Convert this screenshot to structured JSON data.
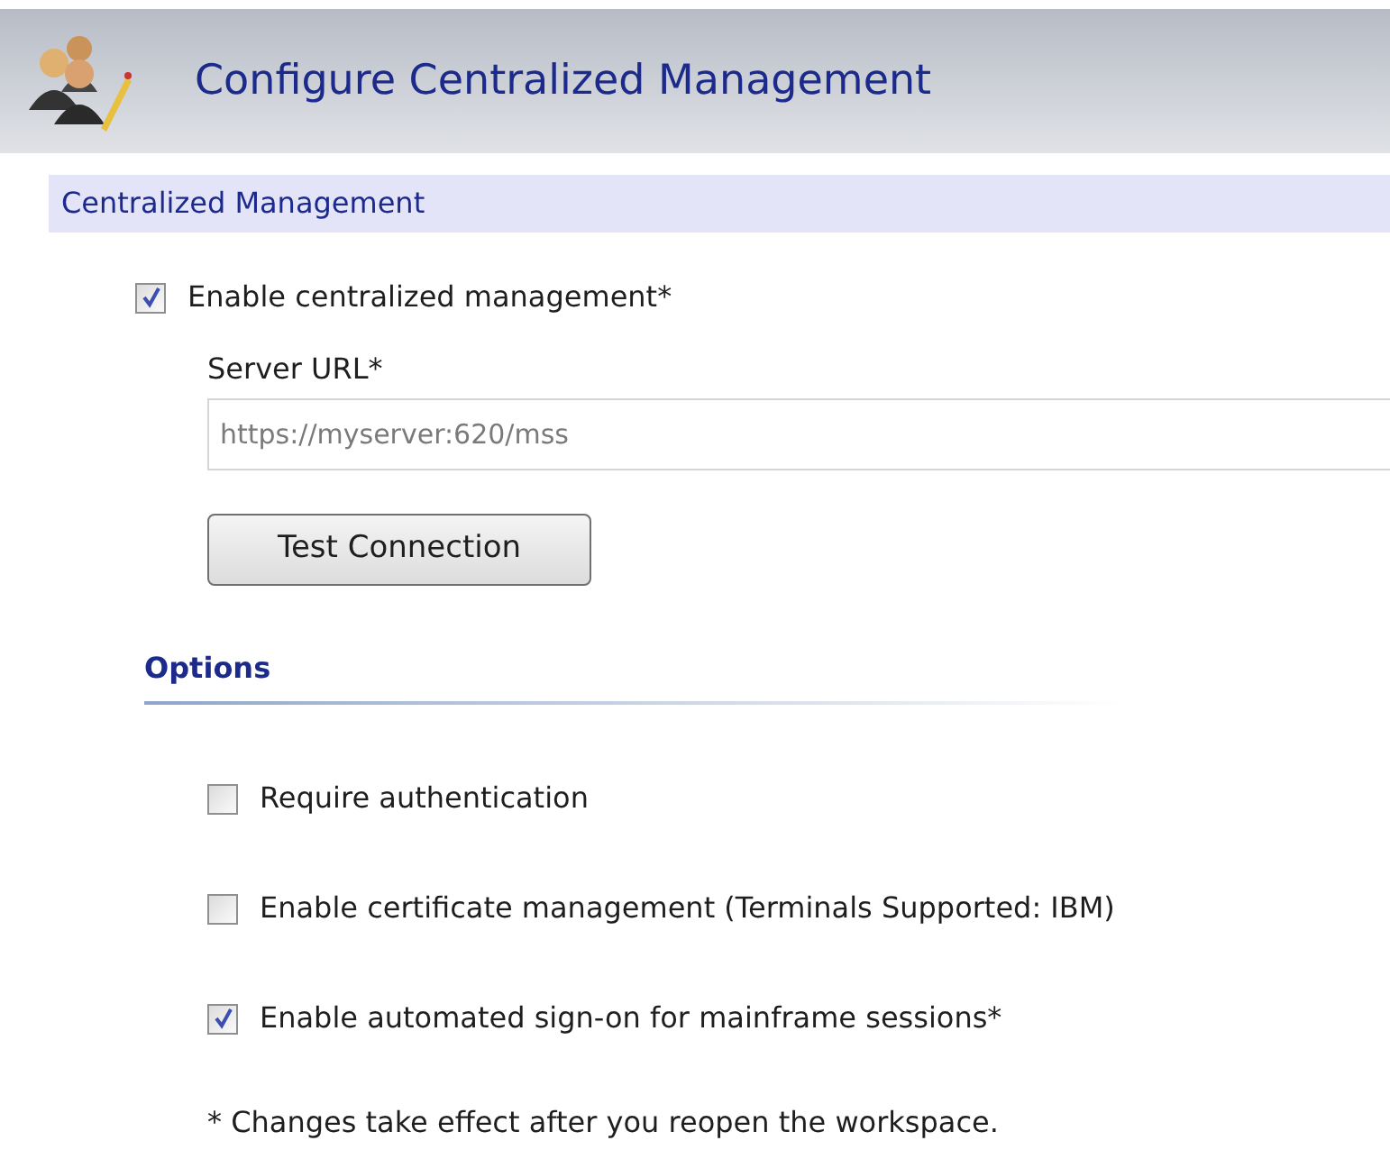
{
  "header": {
    "title": "Configure Centralized Management"
  },
  "section": {
    "title": "Centralized Management"
  },
  "enable": {
    "label": "Enable centralized management*",
    "checked": true
  },
  "server_url": {
    "label": "Server URL*",
    "placeholder": "https://myserver:620/mss"
  },
  "test_button": {
    "label": "Test Connection"
  },
  "options": {
    "title": "Options",
    "items": [
      {
        "label": "Require authentication",
        "checked": false
      },
      {
        "label": "Enable certificate management (Terminals Supported: IBM)",
        "checked": false
      },
      {
        "label": "Enable automated sign-on for mainframe sessions*",
        "checked": true
      }
    ]
  },
  "footnote": "* Changes take effect after you reopen the workspace."
}
